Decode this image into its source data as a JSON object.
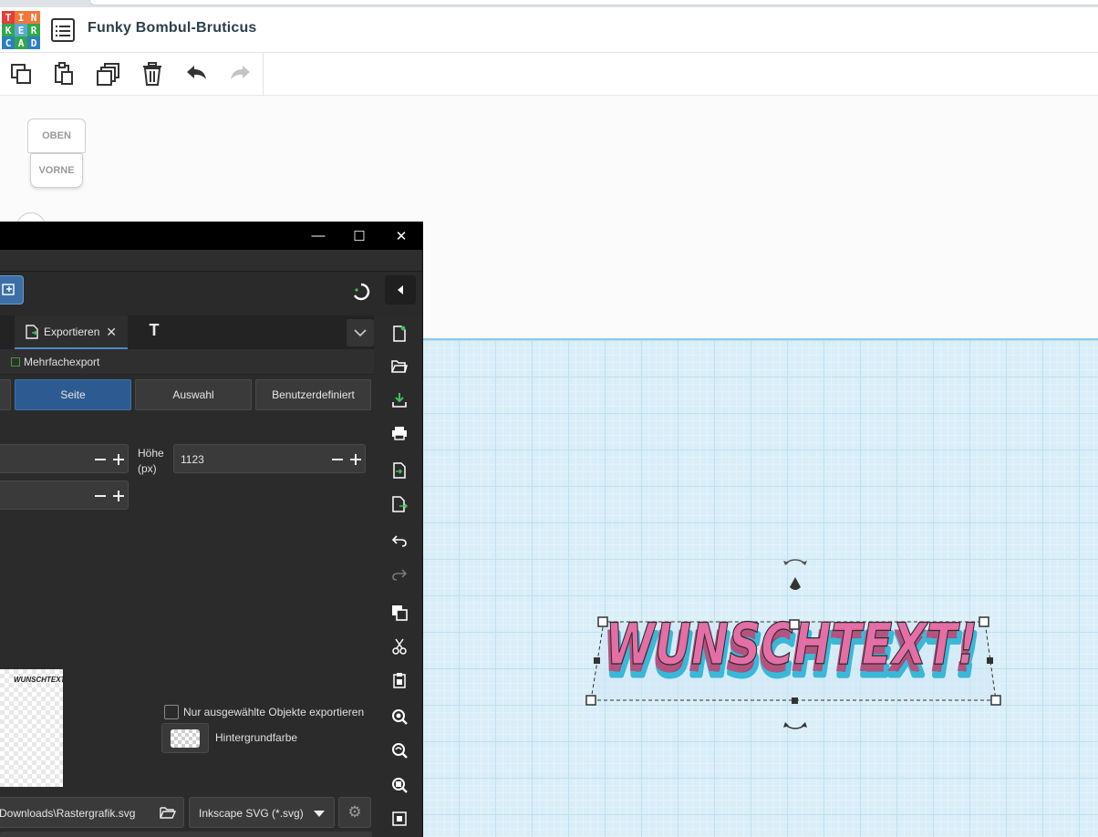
{
  "tinkercad": {
    "logo_letters": [
      "T",
      "I",
      "N",
      "K",
      "E",
      "R",
      "C",
      "A",
      "D"
    ],
    "logo_colors": [
      "#e2403a",
      "#f0783a",
      "#f0783a",
      "#2fa84a",
      "#5aa7dc",
      "#2fa84a",
      "#2e7fc2",
      "#2fa84a",
      "#2e7fc2"
    ],
    "project_title": "Funky Bombul-Bruticus",
    "toolbar": {
      "copy": "copy-icon",
      "paste": "paste-icon",
      "duplicate": "duplicate-icon",
      "delete": "trash-icon",
      "undo": "undo-icon",
      "redo": "redo-icon"
    },
    "viewcube": {
      "top": "OBEN",
      "front": "VORNE"
    },
    "model_text": "WUNSCHTEXT!",
    "model_color": "#e46ea6",
    "outline_color": "#3ab8d8"
  },
  "inkscape": {
    "window_controls": {
      "minimize": "—",
      "maximize": "☐",
      "close": "✕"
    },
    "tab_export_label": "Exportieren",
    "tab_close": "✕",
    "tab_text_glyph": "T",
    "multi_export_label": "Mehrfachexport",
    "area_buttons": [
      "Seite",
      "Auswahl",
      "Benutzerdefiniert"
    ],
    "height_label_line1": "Höhe",
    "height_label_line2": "(px)",
    "height_value": "1123",
    "preview_text": "WUNSCHTEXT",
    "only_selected_label": "Nur ausgewählte Objekte exportieren",
    "background_label": "Hintergrundfarbe",
    "filename_value": "Downloads\\Rastergrafik.svg",
    "filetype_value": "Inkscape SVG (*.svg)",
    "gear_glyph": "⚙",
    "accent_color": "#2d5b91"
  }
}
